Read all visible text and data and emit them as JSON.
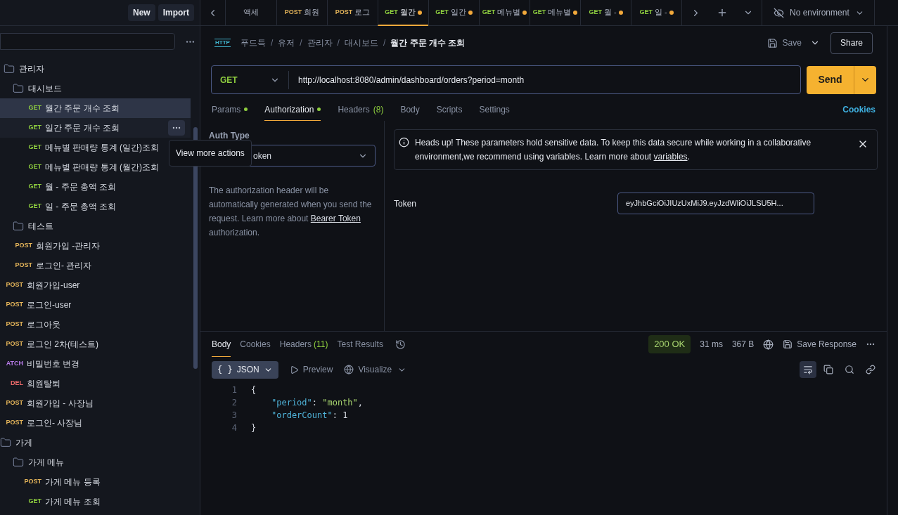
{
  "topbar": {
    "buttons": [
      "New",
      "Import"
    ]
  },
  "tabs": [
    {
      "name": "액세",
      "selected": false,
      "dirty": false
    },
    {
      "method": "POST",
      "name": "회원",
      "selected": false,
      "dirty": false
    },
    {
      "method": "POST",
      "name": "로그",
      "selected": false,
      "dirty": false
    },
    {
      "method": "GET",
      "name": "월간",
      "selected": true,
      "dirty": true
    },
    {
      "method": "GET",
      "name": "일간",
      "selected": false,
      "dirty": true
    },
    {
      "method": "GET",
      "name": "메뉴별",
      "selected": false,
      "dirty": true
    },
    {
      "method": "GET",
      "name": "메뉴별",
      "selected": false,
      "dirty": true
    },
    {
      "method": "GET",
      "name": "월 -",
      "selected": false,
      "dirty": true
    },
    {
      "method": "GET",
      "name": "일 -",
      "selected": false,
      "dirty": true
    }
  ],
  "environment": "No environment",
  "tree": [
    {
      "kind": "folder",
      "name": "관리자",
      "children": [
        {
          "kind": "folder",
          "name": "대시보드",
          "children": [
            {
              "kind": "request",
              "method": "GET",
              "name": "월간 주문 개수 조회",
              "selected": true,
              "hovered": false
            },
            {
              "kind": "request",
              "method": "GET",
              "name": "일간 주문 개수 조회",
              "selected": false,
              "hovered": true
            },
            {
              "kind": "request",
              "method": "GET",
              "name": "메뉴별 판매량 통계 (일간)조회",
              "selected": false,
              "hovered": false
            },
            {
              "kind": "request",
              "method": "GET",
              "name": "메뉴별 판매량 통계 (월간)조회",
              "selected": false,
              "hovered": false
            },
            {
              "kind": "request",
              "method": "GET",
              "name": "월 - 주문 총액 조회",
              "selected": false,
              "hovered": false
            },
            {
              "kind": "request",
              "method": "GET",
              "name": "일 - 주문 총액 조회",
              "selected": false,
              "hovered": false
            }
          ]
        },
        {
          "kind": "folder",
          "name": "테스트"
        },
        {
          "kind": "request",
          "method": "POST",
          "name": "회원가입 -관리자",
          "selected": false,
          "hovered": false
        },
        {
          "kind": "request",
          "method": "POST",
          "name": "로그인- 관리자",
          "selected": false,
          "hovered": false
        }
      ]
    },
    {
      "kind": "request",
      "method": "POST",
      "name": "회원가입-user",
      "selected": false,
      "hovered": false
    },
    {
      "kind": "request",
      "method": "POST",
      "name": "로그인-user",
      "selected": false,
      "hovered": false
    },
    {
      "kind": "request",
      "method": "POST",
      "name": "로그아웃",
      "selected": false,
      "hovered": false
    },
    {
      "kind": "request",
      "method": "POST",
      "name": "로그인 2차(테스트)",
      "selected": false,
      "hovered": false
    },
    {
      "kind": "request",
      "method": "ATCH",
      "name": "비밀번호 변경",
      "selected": false,
      "hovered": false
    },
    {
      "kind": "request",
      "method": "DEL",
      "name": "회원탈퇴",
      "selected": false,
      "hovered": false
    },
    {
      "kind": "request",
      "method": "POST",
      "name": "회원가입 - 사장님",
      "selected": false,
      "hovered": false
    },
    {
      "kind": "request",
      "method": "POST",
      "name": "로그인- 사장님",
      "selected": false,
      "hovered": false
    },
    {
      "kind": "root-folder",
      "name": "가게",
      "children": [
        {
          "kind": "folder",
          "name": "가게 메뉴",
          "children": [
            {
              "kind": "request",
              "method": "POST",
              "name": "가게 메뉴 등록",
              "selected": false,
              "hovered": false
            },
            {
              "kind": "request",
              "method": "GET",
              "name": "가게 메뉴 조회",
              "selected": false,
              "hovered": false
            }
          ]
        }
      ]
    }
  ],
  "tooltip": "View more actions",
  "http_badge": "HTTP",
  "breadcrumb_separator": "/",
  "breadcrumb": [
    "푸드득",
    "유저",
    "관리자",
    "대시보드",
    "월간 주문 개수 조회"
  ],
  "save": "Save",
  "share": "Share",
  "request": {
    "method": "GET",
    "url": "http://localhost:8080/admin/dashboard/orders?period=month",
    "send": "Send"
  },
  "request_tabs": [
    {
      "label": "Params",
      "dot": true,
      "selected": false
    },
    {
      "label": "Authorization",
      "dot": true,
      "selected": true
    },
    {
      "label": "Headers",
      "count": "(8)",
      "dot": false,
      "selected": false
    },
    {
      "label": "Body",
      "dot": false,
      "selected": false
    },
    {
      "label": "Scripts",
      "dot": false,
      "selected": false
    },
    {
      "label": "Settings",
      "dot": false,
      "selected": false
    }
  ],
  "cookies": "Cookies",
  "auth": {
    "type_label": "Auth Type",
    "type_value": "oken",
    "help": "The authorization header will be automatically generated when you send the request. Learn more about",
    "help_link": "Bearer Token",
    "help_end": "authorization.",
    "alert": "Heads up! These parameters hold sensitive data. To keep this data secure while working in a collaborative environment,we recommend using variables. Learn more about",
    "alert_link": "variables",
    "alert_end": ".",
    "token_label": "Token",
    "token_value": "eyJhbGciOiJIUzUxMiJ9.eyJzdWliOiJLSU5H..."
  },
  "response": {
    "tabs": [
      {
        "label": "Body",
        "selected": true
      },
      {
        "label": "Cookies",
        "selected": false
      },
      {
        "label": "Headers",
        "count": "(11)",
        "selected": false
      },
      {
        "label": "Test Results",
        "selected": false
      }
    ],
    "status": "200 OK",
    "time": "31 ms",
    "size": "367 B",
    "save": "Save Response",
    "format_icon": "{ }",
    "format": "JSON",
    "preview": "Preview",
    "visualize": "Visualize",
    "lines": [
      {
        "number": "1",
        "tokens": [
          {
            "kind": "punct",
            "text": "{"
          }
        ]
      },
      {
        "number": "2",
        "tokens": [
          {
            "kind": "key",
            "text": "\"period\""
          },
          {
            "kind": "punct",
            "text": ": "
          },
          {
            "kind": "string",
            "text": "\"month\""
          },
          {
            "kind": "punct",
            "text": ","
          }
        ]
      },
      {
        "number": "3",
        "tokens": [
          {
            "kind": "key",
            "text": "\"orderCount\""
          },
          {
            "kind": "punct",
            "text": ": "
          },
          {
            "kind": "number",
            "text": "1"
          }
        ]
      },
      {
        "number": "4",
        "tokens": [
          {
            "kind": "punct",
            "text": "}"
          }
        ]
      }
    ]
  }
}
